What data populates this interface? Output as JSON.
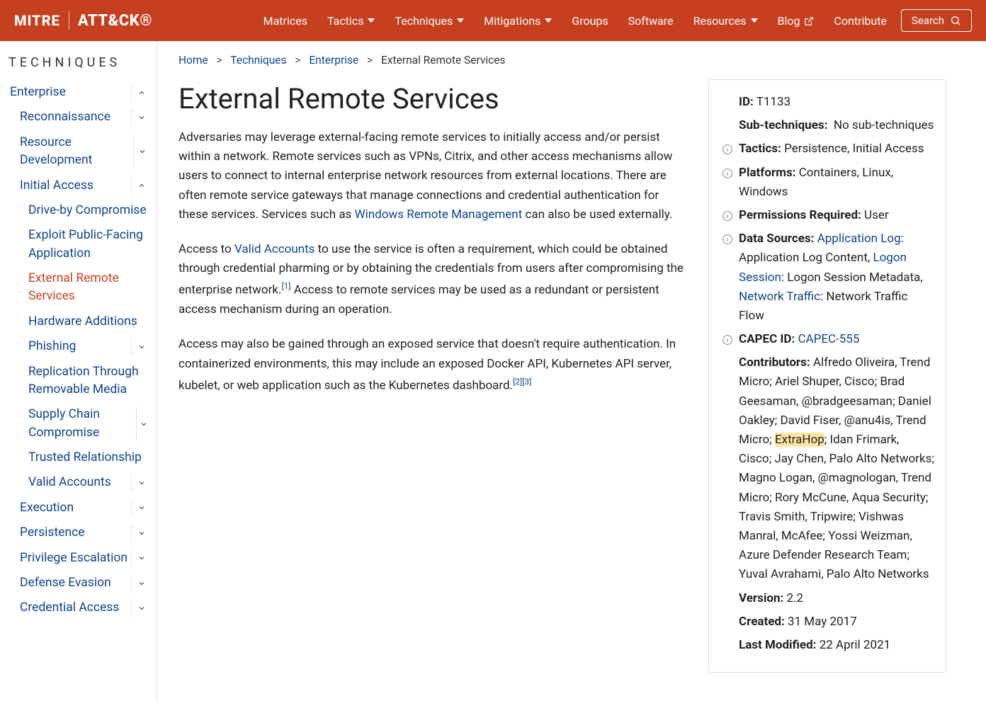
{
  "brand": {
    "mitre": "MITRE",
    "attck": "ATT&CK®"
  },
  "nav": {
    "matrices": "Matrices",
    "tactics": "Tactics",
    "techniques": "Techniques",
    "mitigations": "Mitigations",
    "groups": "Groups",
    "software": "Software",
    "resources": "Resources",
    "blog": "Blog",
    "contribute": "Contribute",
    "search": "Search"
  },
  "sidebar": {
    "title": "TECHNIQUES",
    "enterprise": "Enterprise",
    "recon": "Reconnaissance",
    "resdev": "Resource Development",
    "initial": "Initial Access",
    "driveby": "Drive-by Compromise",
    "exploitpf": "Exploit Public-Facing Application",
    "extrs": "External Remote Services",
    "hwadd": "Hardware Additions",
    "phish": "Phishing",
    "replrm": "Replication Through Removable Media",
    "supply": "Supply Chain Compromise",
    "trusted": "Trusted Relationship",
    "validacc": "Valid Accounts",
    "exec": "Execution",
    "persist": "Persistence",
    "privesc": "Privilege Escalation",
    "defeva": "Defense Evasion",
    "credacc": "Credential Access"
  },
  "breadcrumbs": {
    "home": "Home",
    "techniques": "Techniques",
    "enterprise": "Enterprise",
    "current": "External Remote Services"
  },
  "page": {
    "title": "External Remote Services",
    "p1a": "Adversaries may leverage external-facing remote services to initially access and/or persist within a network. Remote services such as VPNs, Citrix, and other access mechanisms allow users to connect to internal enterprise network resources from external locations. There are often remote service gateways that manage connections and credential authentication for these services. Services such as ",
    "p1link": "Windows Remote Management",
    "p1b": " can also be used externally.",
    "p2a": "Access to ",
    "p2link": "Valid Accounts",
    "p2b": " to use the service is often a requirement, which could be obtained through credential pharming or by obtaining the credentials from users after compromising the enterprise network.",
    "cite1": "[1]",
    "p2c": " Access to remote services may be used as a redundant or persistent access mechanism during an operation.",
    "p3a": "Access may also be gained through an exposed service that doesn't require authentication. In containerized environments, this may include an exposed Docker API, Kubernetes API server, kubelet, or web application such as the Kubernetes dashboard.",
    "cite2": "[2]",
    "cite3": "[3]"
  },
  "card": {
    "id_k": "ID:",
    "id_v": "T1133",
    "sub_k": "Sub-techniques:",
    "sub_v": "No sub-techniques",
    "tac_k": "Tactics:",
    "tac_v": "Persistence, Initial Access",
    "plat_k": "Platforms:",
    "plat_v": "Containers, Linux, Windows",
    "perm_k": "Permissions Required:",
    "perm_v": "User",
    "ds_k": "Data Sources:",
    "ds_l1": "Application Log",
    "ds_t1": ": Application Log Content, ",
    "ds_l2": "Logon Session",
    "ds_t2": ": Logon Session Metadata, ",
    "ds_l3": "Network Traffic",
    "ds_t3": ": Network Traffic Flow",
    "capec_k": "CAPEC ID:",
    "capec_v": "CAPEC-555",
    "contrib_k": "Contributors:",
    "contrib_a": "Alfredo Oliveira, Trend Micro; Ariel Shuper, Cisco; Brad Geesaman, @bradgeesaman; Daniel Oakley; David Fiser, @anu4is, Trend Micro; ",
    "contrib_hl": "ExtraHop",
    "contrib_b": "; Idan Frimark, Cisco; Jay Chen, Palo Alto Networks; Magno Logan, @magnologan, Trend Micro; Rory McCune, Aqua Security; Travis Smith, Tripwire; Vishwas Manral, McAfee; Yossi Weizman, Azure Defender Research Team; Yuval Avrahami, Palo Alto Networks",
    "ver_k": "Version:",
    "ver_v": "2.2",
    "cre_k": "Created:",
    "cre_v": "31 May 2017",
    "mod_k": "Last Modified:",
    "mod_v": "22 April 2021"
  }
}
